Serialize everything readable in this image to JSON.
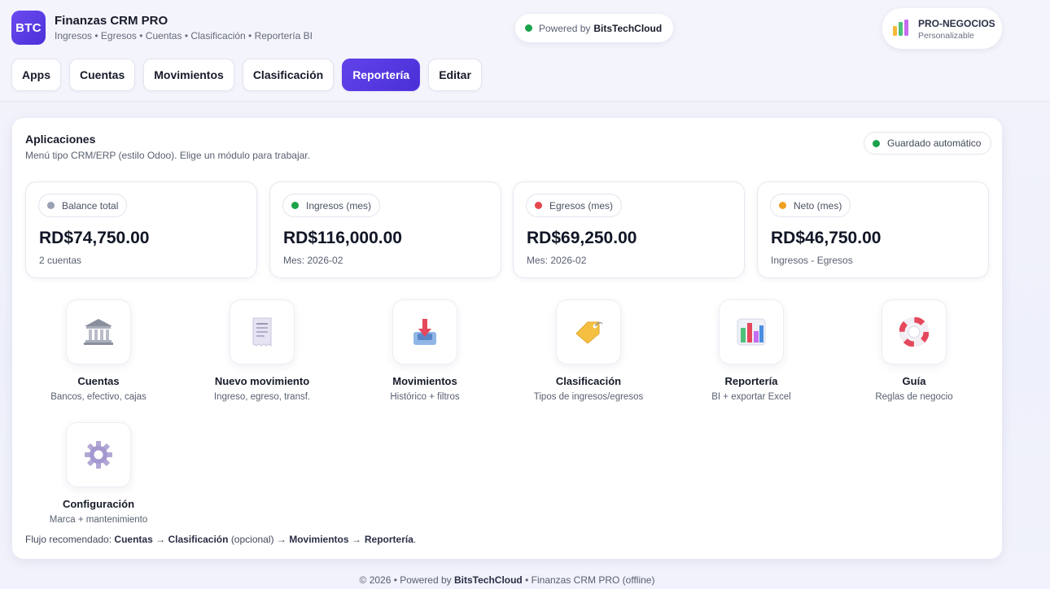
{
  "brand": {
    "logo_text": "BTC",
    "title": "Finanzas CRM PRO",
    "subtitle": "Ingresos • Egresos • Cuentas • Clasificación • Reportería BI",
    "accent": "#5a3be4"
  },
  "powered": {
    "prefix": "Powered by",
    "name": "BitsTechCloud"
  },
  "pro_badge": {
    "title": "PRO-NEGOCIOS",
    "subtitle": "Personalizable"
  },
  "tabs": [
    {
      "label": "Apps",
      "active": false
    },
    {
      "label": "Cuentas",
      "active": false
    },
    {
      "label": "Movimientos",
      "active": false
    },
    {
      "label": "Clasificación",
      "active": false
    },
    {
      "label": "Reportería",
      "active": true
    },
    {
      "label": "Editar",
      "active": false
    }
  ],
  "panel": {
    "title": "Aplicaciones",
    "subtitle": "Menú tipo CRM/ERP (estilo Odoo). Elige un módulo para trabajar.",
    "saved_label": "Guardado automático"
  },
  "kpis": [
    {
      "label": "Balance total",
      "value": "RD$74,750.00",
      "note": "2 cuentas",
      "color": "#9aa1b4"
    },
    {
      "label": "Ingresos (mes)",
      "value": "RD$116,000.00",
      "note": "Mes: 2026-02",
      "color": "#1aa34a"
    },
    {
      "label": "Egresos (mes)",
      "value": "RD$69,250.00",
      "note": "Mes: 2026-02",
      "color": "#e5484d"
    },
    {
      "label": "Neto (mes)",
      "value": "RD$46,750.00",
      "note": "Ingresos - Egresos",
      "color": "#f0a020"
    }
  ],
  "modules": [
    {
      "name": "Cuentas",
      "desc": "Bancos, efectivo, cajas",
      "icon": "bank-icon"
    },
    {
      "name": "Nuevo movimiento",
      "desc": "Ingreso, egreso, transf.",
      "icon": "receipt-icon"
    },
    {
      "name": "Movimientos",
      "desc": "Histórico + filtros",
      "icon": "inbox-tray-icon"
    },
    {
      "name": "Clasificación",
      "desc": "Tipos de ingresos/egresos",
      "icon": "tag-icon"
    },
    {
      "name": "Reportería",
      "desc": "BI + exportar Excel",
      "icon": "bar-chart-icon"
    },
    {
      "name": "Guía",
      "desc": "Reglas de negocio",
      "icon": "lifebuoy-icon"
    },
    {
      "name": "Configuración",
      "desc": "Marca + mantenimiento",
      "icon": "gear-icon"
    }
  ],
  "flow": {
    "prefix": "Flujo recomendado:",
    "step1": "Cuentas",
    "arrow": "→",
    "step2": "Clasificación",
    "optional": "(opcional)",
    "step3": "Movimientos",
    "step4": "Reportería",
    "end": "."
  },
  "footer": {
    "prefix": "© 2026 • Powered by",
    "name": "BitsTechCloud",
    "suffix": "• Finanzas CRM PRO (offline)"
  }
}
